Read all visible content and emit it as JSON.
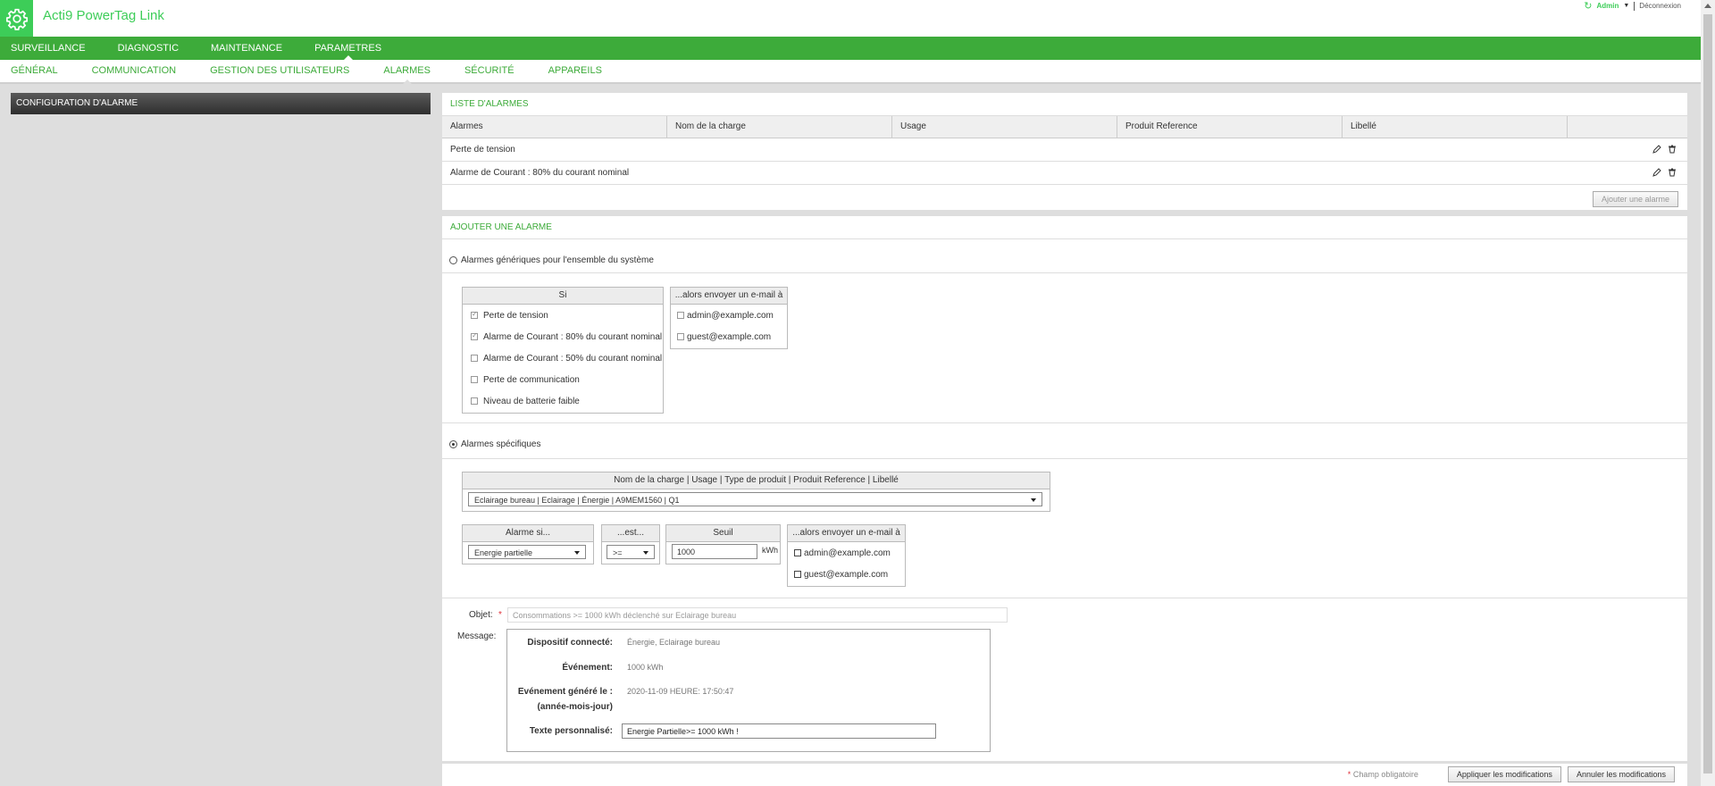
{
  "header": {
    "title": "Acti9 PowerTag Link",
    "user": "Admin",
    "logout": "Déconnexion"
  },
  "nav": {
    "main": [
      "SURVEILLANCE",
      "DIAGNOSTIC",
      "MAINTENANCE",
      "PARAMETRES"
    ],
    "sub": [
      "GÉNÉRAL",
      "COMMUNICATION",
      "GESTION DES UTILISATEURS",
      "ALARMES",
      "SÉCURITÉ",
      "APPAREILS"
    ]
  },
  "sidebar": {
    "title": "CONFIGURATION D'ALARME"
  },
  "alarm_list": {
    "title": "LISTE D'ALARMES",
    "columns": [
      "Alarmes",
      "Nom de la charge",
      "Usage",
      "Produit Reference",
      "Libellé"
    ],
    "rows": [
      "Perte de tension",
      "Alarme de Courant : 80% du courant nominal"
    ],
    "add_button": "Ajouter une alarme"
  },
  "add_alarm": {
    "title": "AJOUTER UNE ALARME",
    "generic_label": "Alarmes génériques pour l'ensemble du système",
    "si_header": "Si",
    "si_items": [
      {
        "label": "Perte de tension",
        "checked": true
      },
      {
        "label": "Alarme de Courant : 80% du courant nominal",
        "checked": true
      },
      {
        "label": "Alarme de Courant : 50% du courant nominal",
        "checked": false
      },
      {
        "label": "Perte de communication",
        "checked": false
      },
      {
        "label": "Niveau de batterie faible",
        "checked": false
      }
    ],
    "email_header": "...alors envoyer un e-mail à",
    "emails": [
      "admin@example.com",
      "guest@example.com"
    ],
    "specific_label": "Alarmes spécifiques",
    "load_header": "Nom de la charge | Usage | Type de produit | Produit Reference | Libellé",
    "load_value": "Eclairage bureau | Eclairage | Énergie | A9MEM1560 | Q1",
    "alarm_if_header": "Alarme si...",
    "alarm_if_value": "Energie partielle",
    "est_header": "...est...",
    "est_value": ">=",
    "seuil_header": "Seuil",
    "seuil_value": "1000",
    "seuil_unit": "kWh",
    "objet_label": "Objet:",
    "required_mark": "*",
    "objet_value": "Consommations >= 1000 kWh déclenché sur Eclairage bureau",
    "message_label": "Message:",
    "msg_device_label": "Dispositif connecté:",
    "msg_device_value": "Énergie, Eclairage bureau",
    "msg_event_label": "Événement:",
    "msg_event_value": "1000 kWh",
    "msg_generated_label": "Evénement généré le :",
    "msg_generated_label2": "(année-mois-jour)",
    "msg_generated_value": "2020-11-09 HEURE: 17:50:47",
    "msg_custom_label": "Texte personnalisé:",
    "msg_custom_value": "Energie Partielle>= 1000 kWh !"
  },
  "footer": {
    "required_note": "Champ obligatoire",
    "apply": "Appliquer les modifications",
    "cancel": "Annuler les modifications"
  }
}
